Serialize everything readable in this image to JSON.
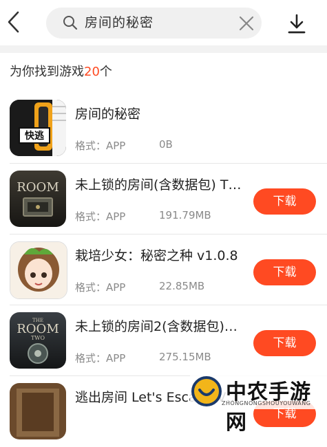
{
  "search": {
    "query": "房间的秘密"
  },
  "summary": {
    "prefix": "为你找到游戏",
    "count": "20",
    "suffix": "个"
  },
  "results": [
    {
      "title": "房间的秘密",
      "format": "格式：APP",
      "size": "0B",
      "button": ""
    },
    {
      "title": "未上锁的房间(含数据包) T…",
      "format": "格式：APP",
      "size": "191.79MB",
      "button": "下载"
    },
    {
      "title": "栽培少女：秘密之种  v1.0.8",
      "format": "格式：APP",
      "size": "22.85MB",
      "button": "下载"
    },
    {
      "title": "未上锁的房间2(含数据包)…",
      "format": "格式：APP",
      "size": "275.15MB",
      "button": "下载"
    },
    {
      "title": "逃出房间 Let's Escape V…",
      "format": "",
      "size": "",
      "button": "下载"
    }
  ],
  "icons": {
    "r0": "kuaitao-icon",
    "r1": "the-room-icon",
    "r2": "girl-icon",
    "r3": "the-room-two-icon",
    "r4": "escape-room-icon"
  },
  "icon_text": {
    "kuaitao": "快逃",
    "room": "ROOM",
    "the": "THE",
    "two": "TWO"
  },
  "watermark": {
    "name": "中农手游网",
    "sub": "ZHONGNONGSHOUYOUWANG"
  },
  "colors": {
    "accent": "#ff4a22"
  }
}
